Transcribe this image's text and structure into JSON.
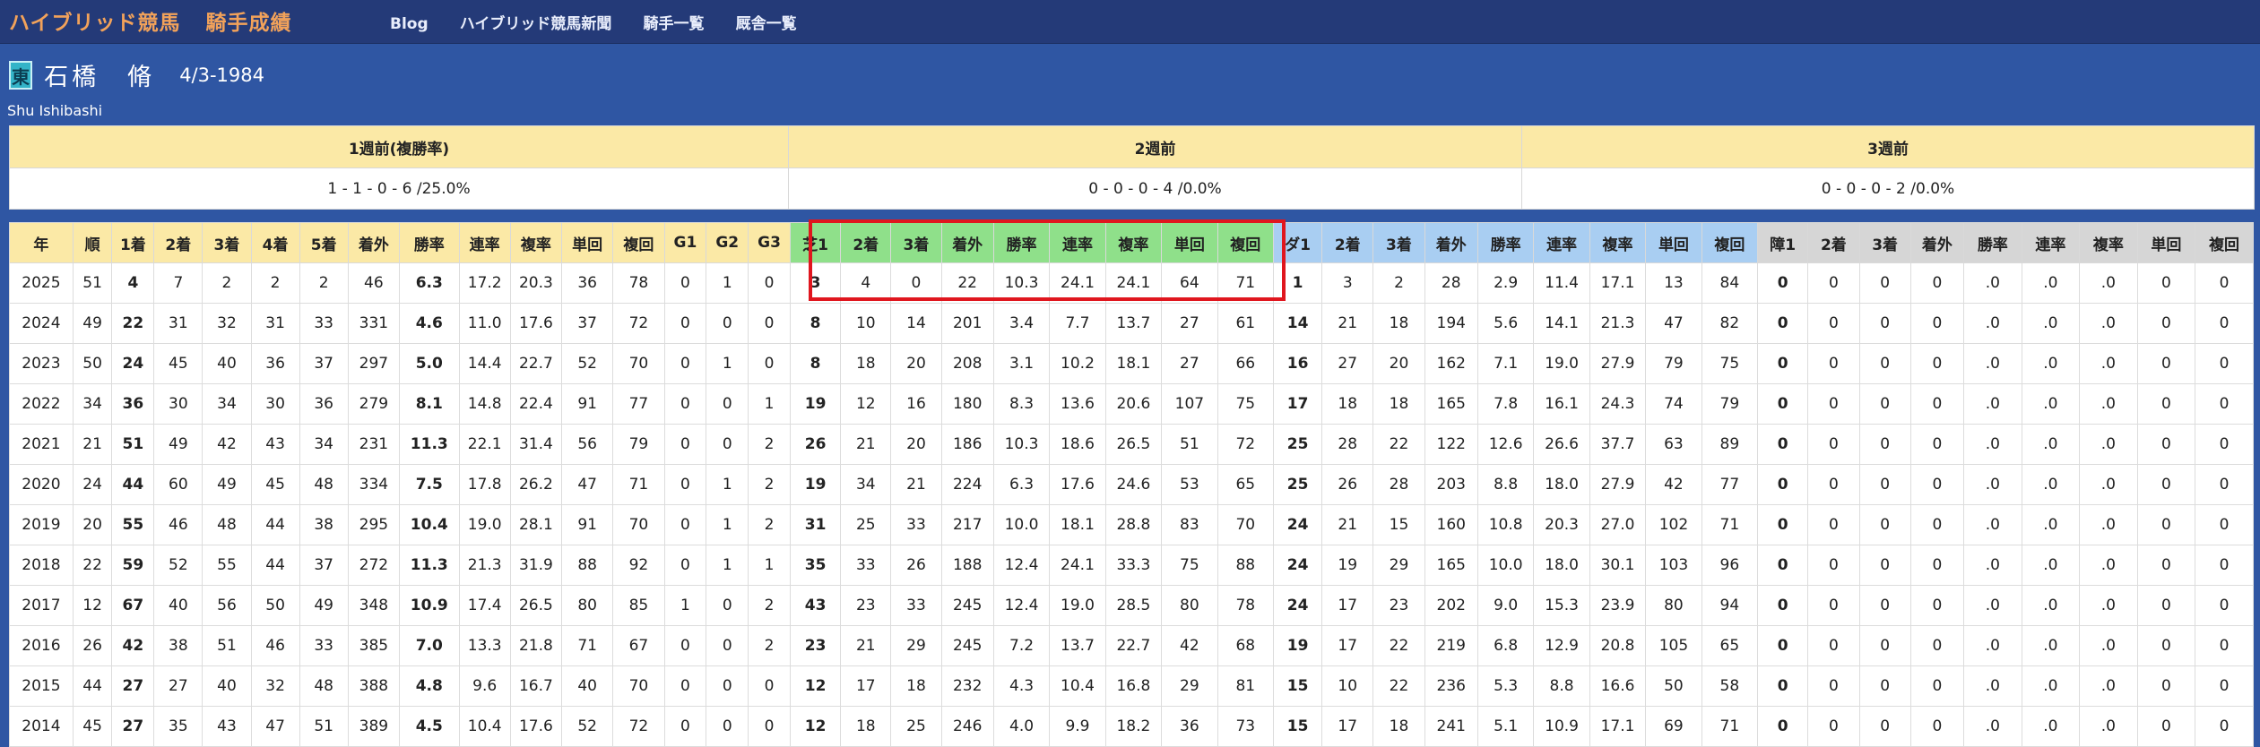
{
  "header": {
    "site_title": "ハイブリッド競馬",
    "section_title": "騎手成績",
    "nav": [
      "Blog",
      "ハイブリッド競馬新聞",
      "騎手一覧",
      "厩舎一覧"
    ]
  },
  "jockey": {
    "affiliation": "東",
    "name": "石橋　脩",
    "birthdate": "4/3-1984",
    "romaji": "Shu Ishibashi"
  },
  "weekly": {
    "headers": [
      "1週前(複勝率)",
      "2週前",
      "3週前"
    ],
    "values": [
      "1 - 1 - 0 - 6 /25.0%",
      "0 - 0 - 0 - 4 /0.0%",
      "0 - 0 - 0 - 2 /0.0%"
    ]
  },
  "stats": {
    "columns": [
      "年",
      "順",
      "1着",
      "2着",
      "3着",
      "4着",
      "5着",
      "着外",
      "勝率",
      "連率",
      "複率",
      "単回",
      "複回",
      "G1",
      "G2",
      "G3",
      "芝1",
      "2着",
      "3着",
      "着外",
      "勝率",
      "連率",
      "複率",
      "単回",
      "複回",
      "ダ1",
      "2着",
      "3着",
      "着外",
      "勝率",
      "連率",
      "複率",
      "単回",
      "複回",
      "障1",
      "2着",
      "3着",
      "着外",
      "勝率",
      "連率",
      "複率",
      "単回",
      "複回"
    ],
    "rows": [
      [
        "2025",
        "51",
        "4",
        "7",
        "2",
        "2",
        "2",
        "46",
        "6.3",
        "17.2",
        "20.3",
        "36",
        "78",
        "0",
        "1",
        "0",
        "3",
        "4",
        "0",
        "22",
        "10.3",
        "24.1",
        "24.1",
        "64",
        "71",
        "1",
        "3",
        "2",
        "28",
        "2.9",
        "11.4",
        "17.1",
        "13",
        "84",
        "0",
        "0",
        "0",
        "0",
        ".0",
        ".0",
        ".0",
        "0",
        "0"
      ],
      [
        "2024",
        "49",
        "22",
        "31",
        "32",
        "31",
        "33",
        "331",
        "4.6",
        "11.0",
        "17.6",
        "37",
        "72",
        "0",
        "0",
        "0",
        "8",
        "10",
        "14",
        "201",
        "3.4",
        "7.7",
        "13.7",
        "27",
        "61",
        "14",
        "21",
        "18",
        "194",
        "5.6",
        "14.1",
        "21.3",
        "47",
        "82",
        "0",
        "0",
        "0",
        "0",
        ".0",
        ".0",
        ".0",
        "0",
        "0"
      ],
      [
        "2023",
        "50",
        "24",
        "45",
        "40",
        "36",
        "37",
        "297",
        "5.0",
        "14.4",
        "22.7",
        "52",
        "70",
        "0",
        "1",
        "0",
        "8",
        "18",
        "20",
        "208",
        "3.1",
        "10.2",
        "18.1",
        "27",
        "66",
        "16",
        "27",
        "20",
        "162",
        "7.1",
        "19.0",
        "27.9",
        "79",
        "75",
        "0",
        "0",
        "0",
        "0",
        ".0",
        ".0",
        ".0",
        "0",
        "0"
      ],
      [
        "2022",
        "34",
        "36",
        "30",
        "34",
        "30",
        "36",
        "279",
        "8.1",
        "14.8",
        "22.4",
        "91",
        "77",
        "0",
        "0",
        "1",
        "19",
        "12",
        "16",
        "180",
        "8.3",
        "13.6",
        "20.6",
        "107",
        "75",
        "17",
        "18",
        "18",
        "165",
        "7.8",
        "16.1",
        "24.3",
        "74",
        "79",
        "0",
        "0",
        "0",
        "0",
        ".0",
        ".0",
        ".0",
        "0",
        "0"
      ],
      [
        "2021",
        "21",
        "51",
        "49",
        "42",
        "43",
        "34",
        "231",
        "11.3",
        "22.1",
        "31.4",
        "56",
        "79",
        "0",
        "0",
        "2",
        "26",
        "21",
        "20",
        "186",
        "10.3",
        "18.6",
        "26.5",
        "51",
        "72",
        "25",
        "28",
        "22",
        "122",
        "12.6",
        "26.6",
        "37.7",
        "63",
        "89",
        "0",
        "0",
        "0",
        "0",
        ".0",
        ".0",
        ".0",
        "0",
        "0"
      ],
      [
        "2020",
        "24",
        "44",
        "60",
        "49",
        "45",
        "48",
        "334",
        "7.5",
        "17.8",
        "26.2",
        "47",
        "71",
        "0",
        "1",
        "2",
        "19",
        "34",
        "21",
        "224",
        "6.3",
        "17.6",
        "24.6",
        "53",
        "65",
        "25",
        "26",
        "28",
        "203",
        "8.8",
        "18.0",
        "27.9",
        "42",
        "77",
        "0",
        "0",
        "0",
        "0",
        ".0",
        ".0",
        ".0",
        "0",
        "0"
      ],
      [
        "2019",
        "20",
        "55",
        "46",
        "48",
        "44",
        "38",
        "295",
        "10.4",
        "19.0",
        "28.1",
        "91",
        "70",
        "0",
        "1",
        "2",
        "31",
        "25",
        "33",
        "217",
        "10.0",
        "18.1",
        "28.8",
        "83",
        "70",
        "24",
        "21",
        "15",
        "160",
        "10.8",
        "20.3",
        "27.0",
        "102",
        "71",
        "0",
        "0",
        "0",
        "0",
        ".0",
        ".0",
        ".0",
        "0",
        "0"
      ],
      [
        "2018",
        "22",
        "59",
        "52",
        "55",
        "44",
        "37",
        "272",
        "11.3",
        "21.3",
        "31.9",
        "88",
        "92",
        "0",
        "1",
        "1",
        "35",
        "33",
        "26",
        "188",
        "12.4",
        "24.1",
        "33.3",
        "75",
        "88",
        "24",
        "19",
        "29",
        "165",
        "10.0",
        "18.0",
        "30.1",
        "103",
        "96",
        "0",
        "0",
        "0",
        "0",
        ".0",
        ".0",
        ".0",
        "0",
        "0"
      ],
      [
        "2017",
        "12",
        "67",
        "40",
        "56",
        "50",
        "49",
        "348",
        "10.9",
        "17.4",
        "26.5",
        "80",
        "85",
        "1",
        "0",
        "2",
        "43",
        "23",
        "33",
        "245",
        "12.4",
        "19.0",
        "28.5",
        "80",
        "78",
        "24",
        "17",
        "23",
        "202",
        "9.0",
        "15.3",
        "23.9",
        "80",
        "94",
        "0",
        "0",
        "0",
        "0",
        ".0",
        ".0",
        ".0",
        "0",
        "0"
      ],
      [
        "2016",
        "26",
        "42",
        "38",
        "51",
        "46",
        "33",
        "385",
        "7.0",
        "13.3",
        "21.8",
        "71",
        "67",
        "0",
        "0",
        "2",
        "23",
        "21",
        "29",
        "245",
        "7.2",
        "13.7",
        "22.7",
        "42",
        "68",
        "19",
        "17",
        "22",
        "219",
        "6.8",
        "12.9",
        "20.8",
        "105",
        "65",
        "0",
        "0",
        "0",
        "0",
        ".0",
        ".0",
        ".0",
        "0",
        "0"
      ],
      [
        "2015",
        "44",
        "27",
        "27",
        "40",
        "32",
        "48",
        "388",
        "4.8",
        "9.6",
        "16.7",
        "40",
        "70",
        "0",
        "0",
        "0",
        "12",
        "17",
        "18",
        "232",
        "4.3",
        "10.4",
        "16.8",
        "29",
        "81",
        "15",
        "10",
        "22",
        "236",
        "5.3",
        "8.8",
        "16.6",
        "50",
        "58",
        "0",
        "0",
        "0",
        "0",
        ".0",
        ".0",
        ".0",
        "0",
        "0"
      ],
      [
        "2014",
        "45",
        "27",
        "35",
        "43",
        "47",
        "51",
        "389",
        "4.5",
        "10.4",
        "17.6",
        "52",
        "72",
        "0",
        "0",
        "0",
        "12",
        "18",
        "25",
        "246",
        "4.0",
        "9.9",
        "18.2",
        "36",
        "73",
        "15",
        "17",
        "18",
        "241",
        "5.1",
        "10.9",
        "17.1",
        "69",
        "71",
        "0",
        "0",
        "0",
        "0",
        ".0",
        ".0",
        ".0",
        "0",
        "0"
      ]
    ]
  },
  "colors": {
    "page_background": "#2f56a3",
    "topbar": "#243a78",
    "brand": "#f2a25a",
    "overall_header": "#fbe9a6",
    "turf_header": "#8fe08a",
    "dirt_header": "#a9cef2",
    "jump_header": "#d6d6d6",
    "highlight_box": "#e0161e"
  }
}
